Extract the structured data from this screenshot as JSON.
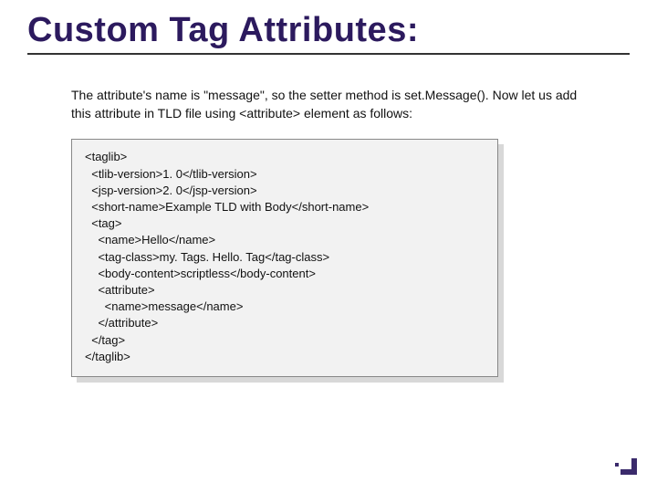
{
  "title": "Custom Tag Attributes:",
  "description": "The attribute's name is \"message\", so the setter method is set.Message(). Now let us add this attribute in TLD file using <attribute> element as follows:",
  "code": "<taglib>\n  <tlib-version>1. 0</tlib-version>\n  <jsp-version>2. 0</jsp-version>\n  <short-name>Example TLD with Body</short-name>\n  <tag>\n    <name>Hello</name>\n    <tag-class>my. Tags. Hello. Tag</tag-class>\n    <body-content>scriptless</body-content>\n    <attribute>\n      <name>message</name>\n    </attribute>\n  </tag>\n</taglib>"
}
